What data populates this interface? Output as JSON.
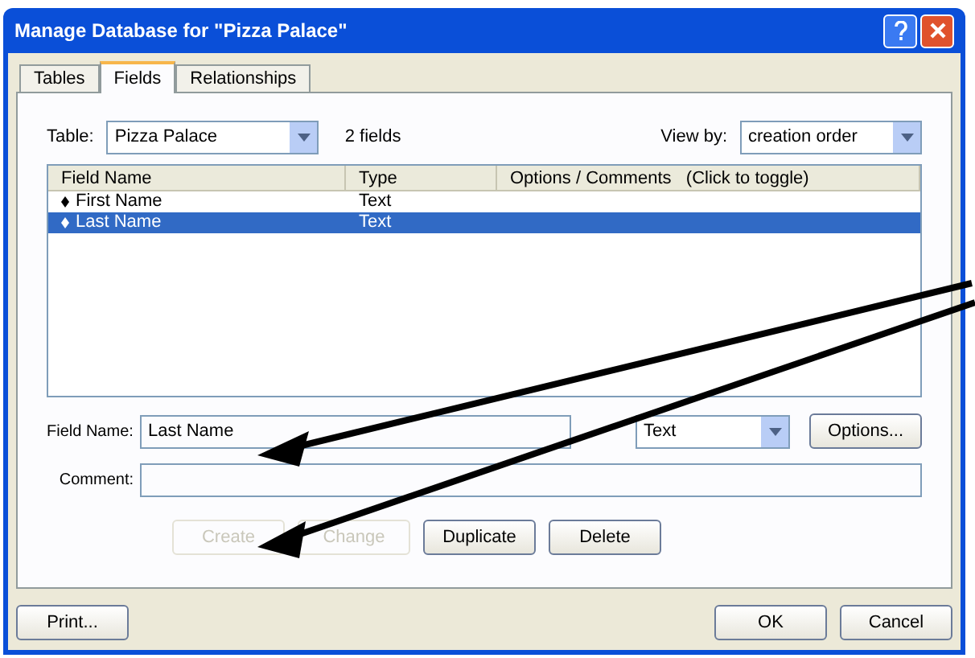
{
  "window": {
    "title": "Manage Database for \"Pizza Palace\""
  },
  "tabs": [
    {
      "label": "Tables",
      "selected": false
    },
    {
      "label": "Fields",
      "selected": true
    },
    {
      "label": "Relationships",
      "selected": false
    }
  ],
  "table_picker": {
    "label": "Table:",
    "value": "Pizza Palace",
    "count": "2 fields"
  },
  "view_by": {
    "label": "View by:",
    "value": "creation order"
  },
  "field_list": {
    "columns": [
      "Field Name",
      "Type",
      "Options / Comments   (Click to toggle)"
    ],
    "rows": [
      {
        "name": "First Name",
        "type": "Text",
        "selected": false
      },
      {
        "name": "Last Name",
        "type": "Text",
        "selected": true
      }
    ]
  },
  "field_name": {
    "label": "Field Name:",
    "value": "Last Name"
  },
  "type_picker": {
    "value": "Text"
  },
  "options_button": "Options...",
  "comment": {
    "label": "Comment:"
  },
  "actions": [
    {
      "label": "Create",
      "disabled": true
    },
    {
      "label": "Change",
      "disabled": true
    },
    {
      "label": "Duplicate",
      "disabled": false
    },
    {
      "label": "Delete",
      "disabled": false
    }
  ],
  "footer": {
    "print": "Print...",
    "ok": "OK",
    "cancel": "Cancel"
  }
}
